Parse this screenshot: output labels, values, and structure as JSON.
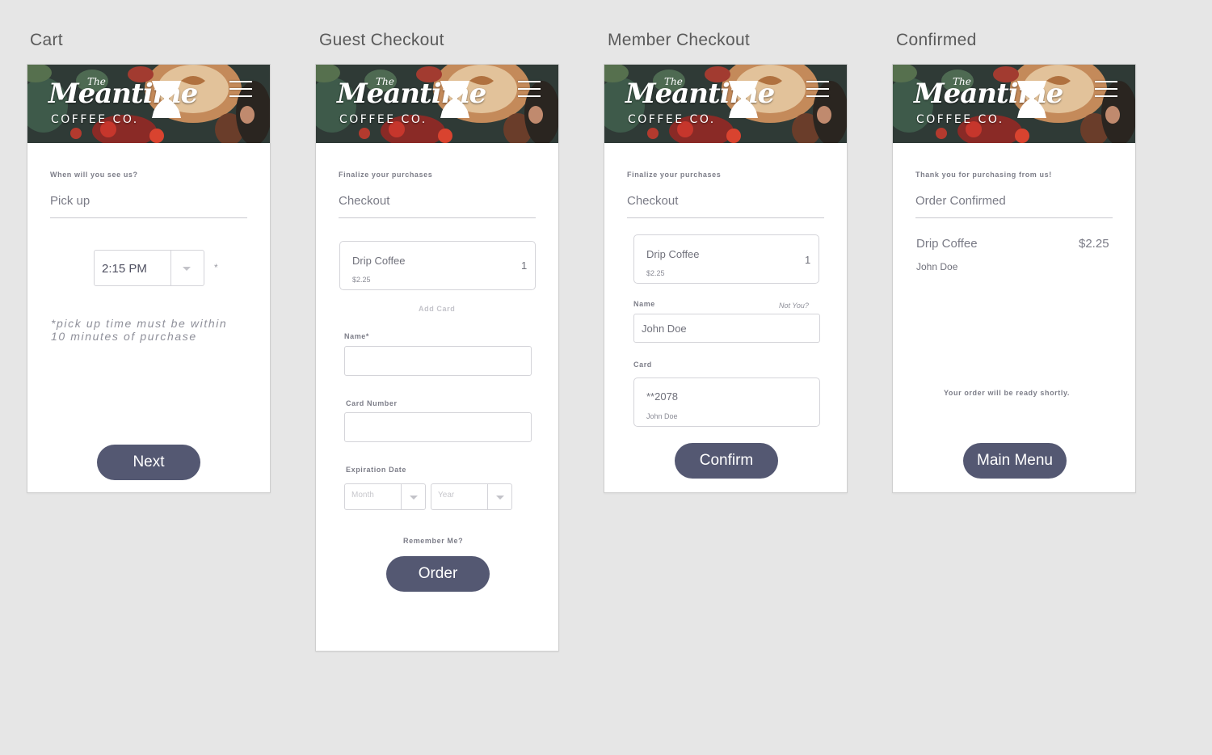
{
  "brand": {
    "the": "The",
    "script": "Meantime",
    "sub": "COFFEE CO."
  },
  "colors": {
    "button": "#545872",
    "background": "#e6e6e6"
  },
  "screens": {
    "cart": {
      "title": "Cart",
      "eyebrow": "When will you see us?",
      "heading": "Pick up",
      "time_value": "2:15 PM",
      "required_mark": "*",
      "note": "*pick up time must be within 10 minutes of purchase",
      "button": "Next"
    },
    "guest": {
      "title": "Guest Checkout",
      "eyebrow": "Finalize your purchases",
      "heading": "Checkout",
      "item_name": "Drip Coffee",
      "item_qty": "1",
      "item_price": "$2.25",
      "add_card": "Add Card",
      "name_label": "Name*",
      "card_label": "Card Number",
      "exp_label": "Expiration Date",
      "month_placeholder": "Month",
      "year_placeholder": "Year",
      "remember": "Remember Me?",
      "button": "Order"
    },
    "member": {
      "title": "Member Checkout",
      "eyebrow": "Finalize your purchases",
      "heading": "Checkout",
      "item_name": "Drip Coffee",
      "item_qty": "1",
      "item_price": "$2.25",
      "name_label": "Name",
      "not_you": "Not You?",
      "name_value": "John Doe",
      "card_label": "Card",
      "card_value": "**2078",
      "card_holder": "John Doe",
      "button": "Confirm"
    },
    "confirmed": {
      "title": "Confirmed",
      "eyebrow": "Thank you for purchasing from us!",
      "heading": "Order Confirmed",
      "item_name": "Drip Coffee",
      "item_price": "$2.25",
      "customer": "John Doe",
      "ready": "Your order will be ready shortly.",
      "button": "Main Menu"
    }
  }
}
